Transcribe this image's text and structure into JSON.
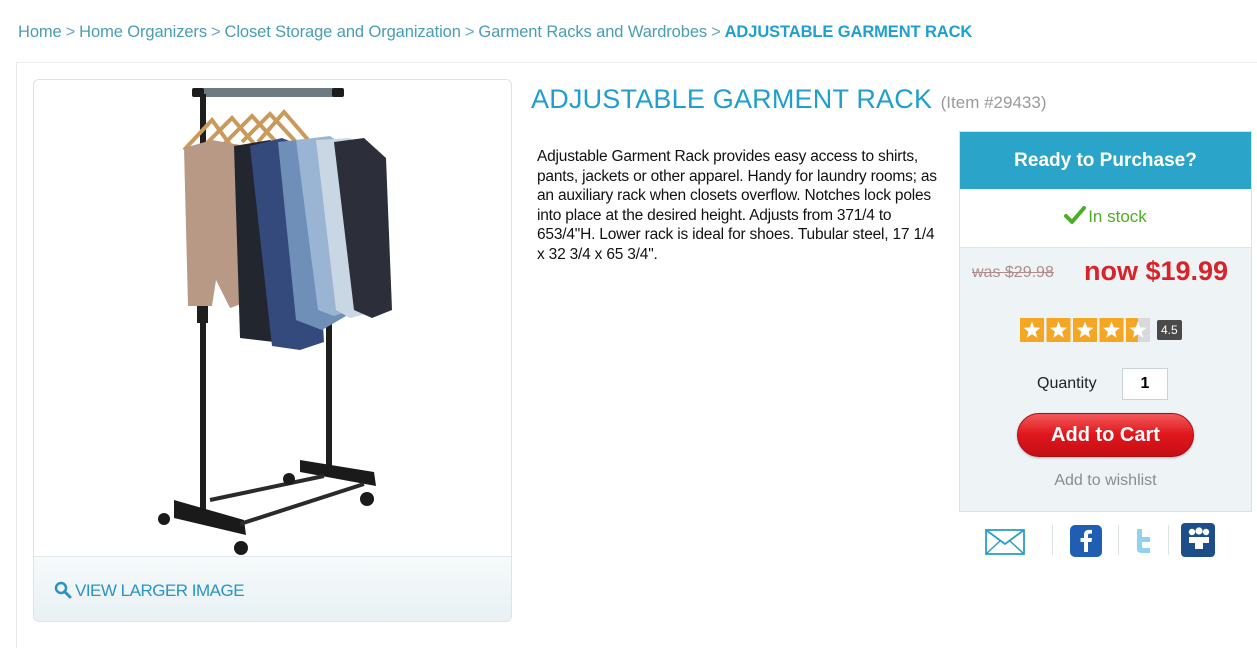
{
  "breadcrumb": {
    "items": [
      "Home",
      "Home Organizers",
      "Closet Storage and Organization",
      "Garment Racks and Wardrobes"
    ],
    "separator": ">",
    "current": "ADJUSTABLE GARMENT RACK"
  },
  "product": {
    "name": "ADJUSTABLE GARMENT RACK",
    "item_number": "(Item #29433)",
    "description": "Adjustable Garment Rack provides easy access to shirts, pants, jackets or other apparel. Handy for laundry rooms; as an auxiliary rack when closets overflow. Notches lock poles into place at the desired height. Adjusts from 371/4 to 653/4\"H. Lower rack is ideal for shoes. Tubular steel, 17 1/4 x 32 3/4 x 65 3/4\".",
    "image_icon": "garment-rack-product-photo",
    "view_larger_label": "VIEW LARGER IMAGE"
  },
  "buybox": {
    "header": "Ready to Purchase?",
    "stock_status": "In stock",
    "was_price": "was $29.98",
    "now_price": "now $19.99",
    "rating": 4.5,
    "rating_label": "4.5",
    "rating_max": 5,
    "quantity_label": "Quantity",
    "quantity_value": "1",
    "add_to_cart_label": "Add to Cart",
    "wishlist_label": "Add to wishlist"
  },
  "share": {
    "icons": [
      "email-icon",
      "facebook-icon",
      "twitter-icon",
      "myspace-icon"
    ]
  },
  "colors": {
    "accent": "#2aa4c8",
    "link": "#1e9fd0",
    "price_red": "#d8232a",
    "in_stock_green": "#4cae25",
    "cart_red": "#e0171d",
    "star_orange": "#f5a623"
  }
}
